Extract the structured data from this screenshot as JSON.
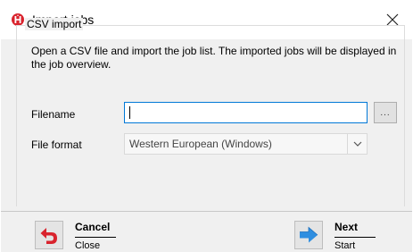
{
  "window": {
    "title": "Import jobs",
    "app_icon": "import-logo-icon",
    "close_icon": "close-icon"
  },
  "group": {
    "legend": "CSV import",
    "description": "Open a CSV file and import the job list. The imported jobs will be displayed in the job overview."
  },
  "form": {
    "filename_label": "Filename",
    "filename_value": "",
    "browse_label": "...",
    "format_label": "File format",
    "format_selected": "Western European (Windows)"
  },
  "footer": {
    "cancel": {
      "title": "Cancel",
      "subtitle": "Close",
      "icon": "undo-arrow-icon"
    },
    "next": {
      "title": "Next",
      "subtitle": "Start",
      "icon": "right-arrow-icon"
    }
  },
  "colors": {
    "accent": "#0078d7",
    "brand_red": "#d9232d",
    "dialog_bg": "#f0f0f0"
  }
}
